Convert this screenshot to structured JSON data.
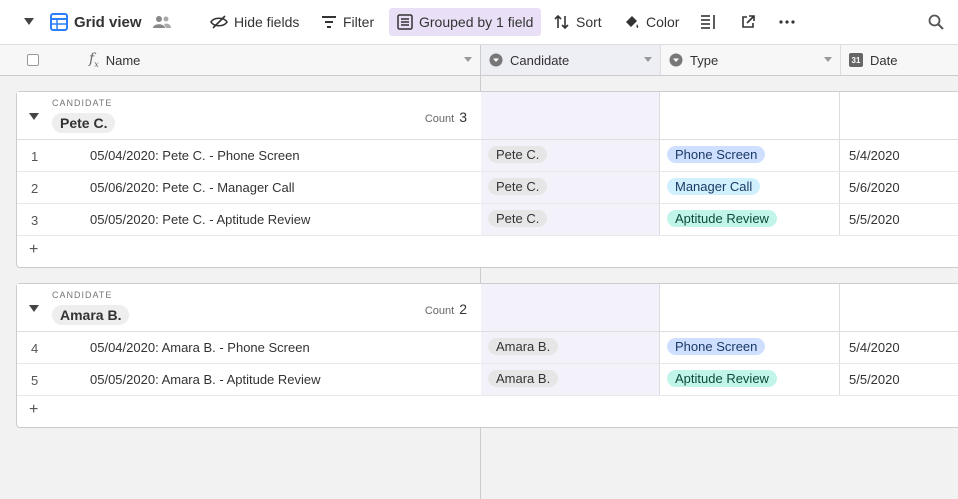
{
  "toolbar": {
    "view_name": "Grid view",
    "hide_fields": "Hide fields",
    "filter": "Filter",
    "grouped": "Grouped by 1 field",
    "sort": "Sort",
    "color": "Color"
  },
  "columns": {
    "name": "Name",
    "candidate": "Candidate",
    "type": "Type",
    "date": "Date"
  },
  "colors": {
    "phone_screen": "#cfdfff",
    "manager_call": "#d0f0fd",
    "aptitude_review": "#c2f5e9",
    "grouped_bg": "#e9e0f7",
    "view_icon": "#2d7ff9"
  },
  "groups": [
    {
      "label": "CANDIDATE",
      "value": "Pete C.",
      "count_label": "Count",
      "count": "3",
      "rows": [
        {
          "num": "1",
          "name": "05/04/2020: Pete C. - Phone Screen",
          "candidate": "Pete C.",
          "type": "Phone Screen",
          "date": "5/4/2020"
        },
        {
          "num": "2",
          "name": "05/06/2020: Pete C. - Manager Call",
          "candidate": "Pete C.",
          "type": "Manager Call",
          "date": "5/6/2020"
        },
        {
          "num": "3",
          "name": "05/05/2020: Pete C. - Aptitude Review",
          "candidate": "Pete C.",
          "type": "Aptitude Review",
          "date": "5/5/2020"
        }
      ]
    },
    {
      "label": "CANDIDATE",
      "value": "Amara B.",
      "count_label": "Count",
      "count": "2",
      "rows": [
        {
          "num": "4",
          "name": "05/04/2020: Amara B. - Phone Screen",
          "candidate": "Amara B.",
          "type": "Phone Screen",
          "date": "5/4/2020"
        },
        {
          "num": "5",
          "name": "05/05/2020: Amara B. - Aptitude Review",
          "candidate": "Amara B.",
          "type": "Aptitude Review",
          "date": "5/5/2020"
        }
      ]
    }
  ],
  "add_row_symbol": "+",
  "date_icon_text": "31"
}
